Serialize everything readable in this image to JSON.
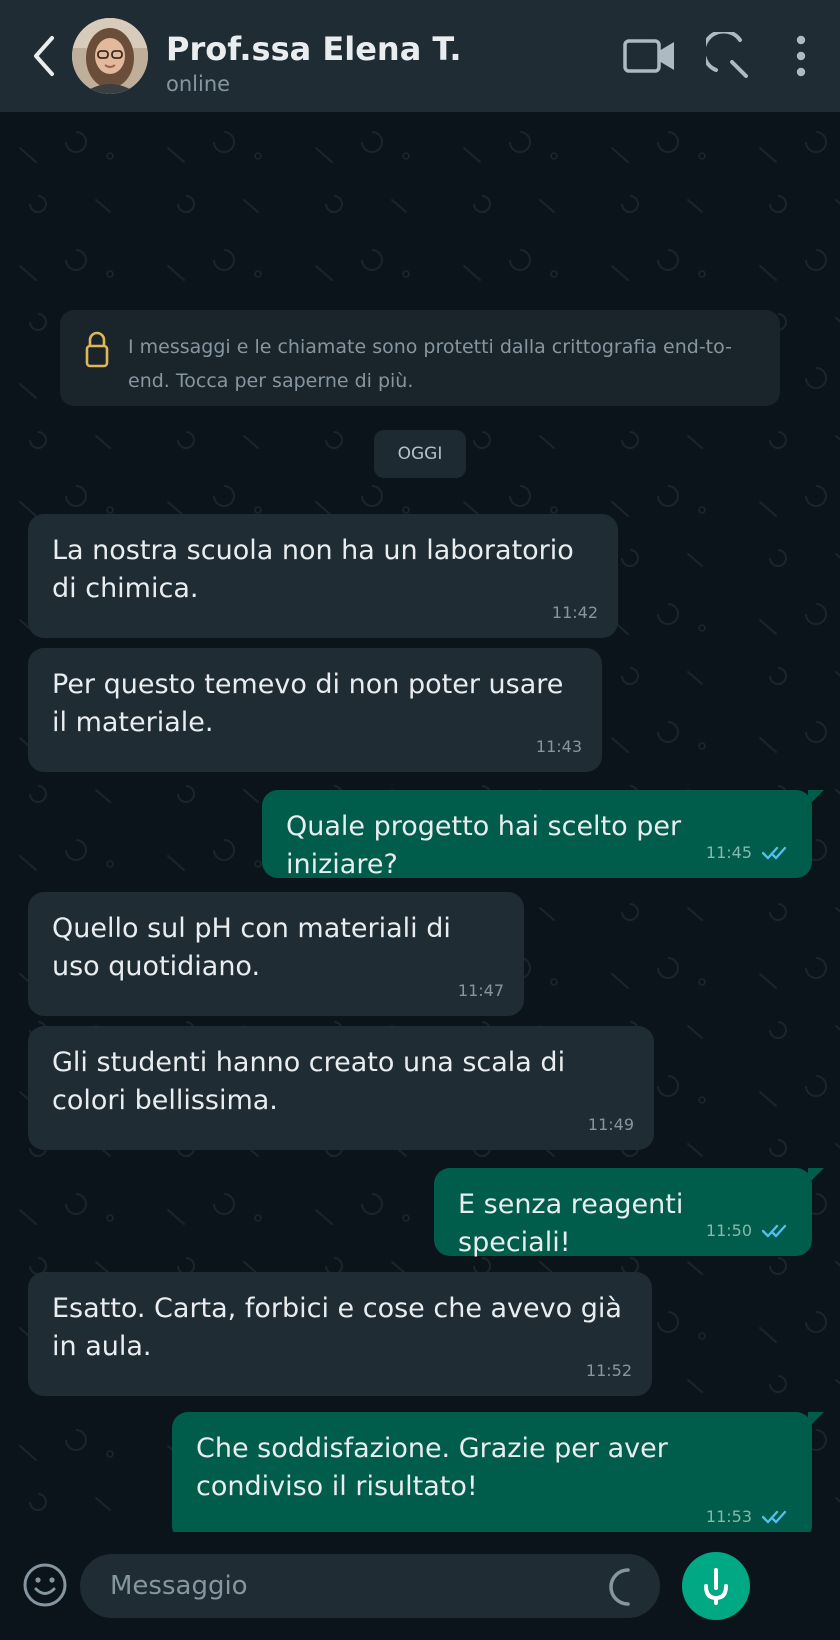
{
  "header": {
    "contact_name": "Prof.ssa Elena T.",
    "status": "online"
  },
  "encryption_notice": "I messaggi e le chiamate sono protetti dalla crittografia end-to-end. Tocca per saperne di più.",
  "date_chip": "OGGI",
  "messages": [
    {
      "dir": "in",
      "text": "La nostra scuola non ha un laboratorio di chimica.",
      "time": "11:42"
    },
    {
      "dir": "in",
      "text": "Per questo temevo di non poter usare il materiale.",
      "time": "11:43"
    },
    {
      "dir": "out",
      "text": "Quale progetto hai scelto per iniziare?",
      "time": "11:45",
      "status": "read"
    },
    {
      "dir": "in",
      "text": "Quello sul pH con materiali di uso quotidiano.",
      "time": "11:47"
    },
    {
      "dir": "in",
      "text": "Gli studenti hanno creato una scala di colori bellissima.",
      "time": "11:49"
    },
    {
      "dir": "out",
      "text": "E senza reagenti speciali!",
      "time": "11:50",
      "status": "read"
    },
    {
      "dir": "in",
      "text": "Esatto. Carta, forbici e cose che avevo già in aula.",
      "time": "11:52"
    },
    {
      "dir": "out",
      "text": "Che soddisfazione. Grazie per aver condiviso il risultato!",
      "time": "11:53",
      "status": "read"
    }
  ],
  "input": {
    "placeholder": "Messaggio"
  },
  "icons": {
    "back": "back-arrow-icon",
    "video": "video-call-icon",
    "call": "phone-call-icon",
    "menu": "more-vert-icon",
    "emoji": "emoji-icon",
    "camera": "camera-icon",
    "mic": "mic-icon"
  },
  "colors": {
    "header_bg": "#1f2c34",
    "chat_bg": "#0b141a",
    "incoming_bubble": "#1f2c34",
    "outgoing_bubble": "#005c4b",
    "accent": "#00a884",
    "read_ticks": "#53bdeb"
  }
}
